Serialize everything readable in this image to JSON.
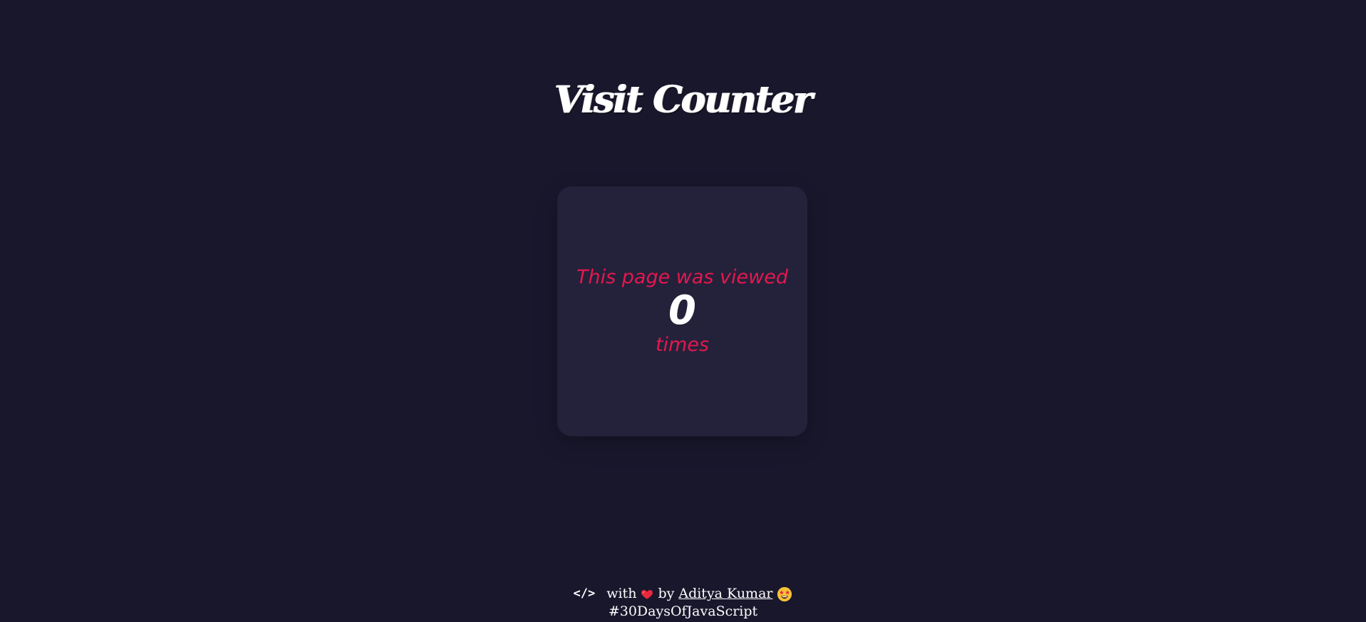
{
  "header": {
    "title": "Visit Counter"
  },
  "counter_card": {
    "prefix_text": "This page was viewed",
    "count": "0",
    "suffix_text": "times"
  },
  "footer": {
    "code_symbol": "</>",
    "with_text": "with",
    "heart_icon": "red-heart",
    "by_text": "by",
    "author_name": "Aditya Kumar",
    "author_emoji_icon": "star-struck-face",
    "hashtag": "#30DaysOfJavaScript"
  },
  "colors": {
    "background": "#19172c",
    "card": "#23223a",
    "accent": "#e5174f",
    "text": "#ffffff"
  }
}
